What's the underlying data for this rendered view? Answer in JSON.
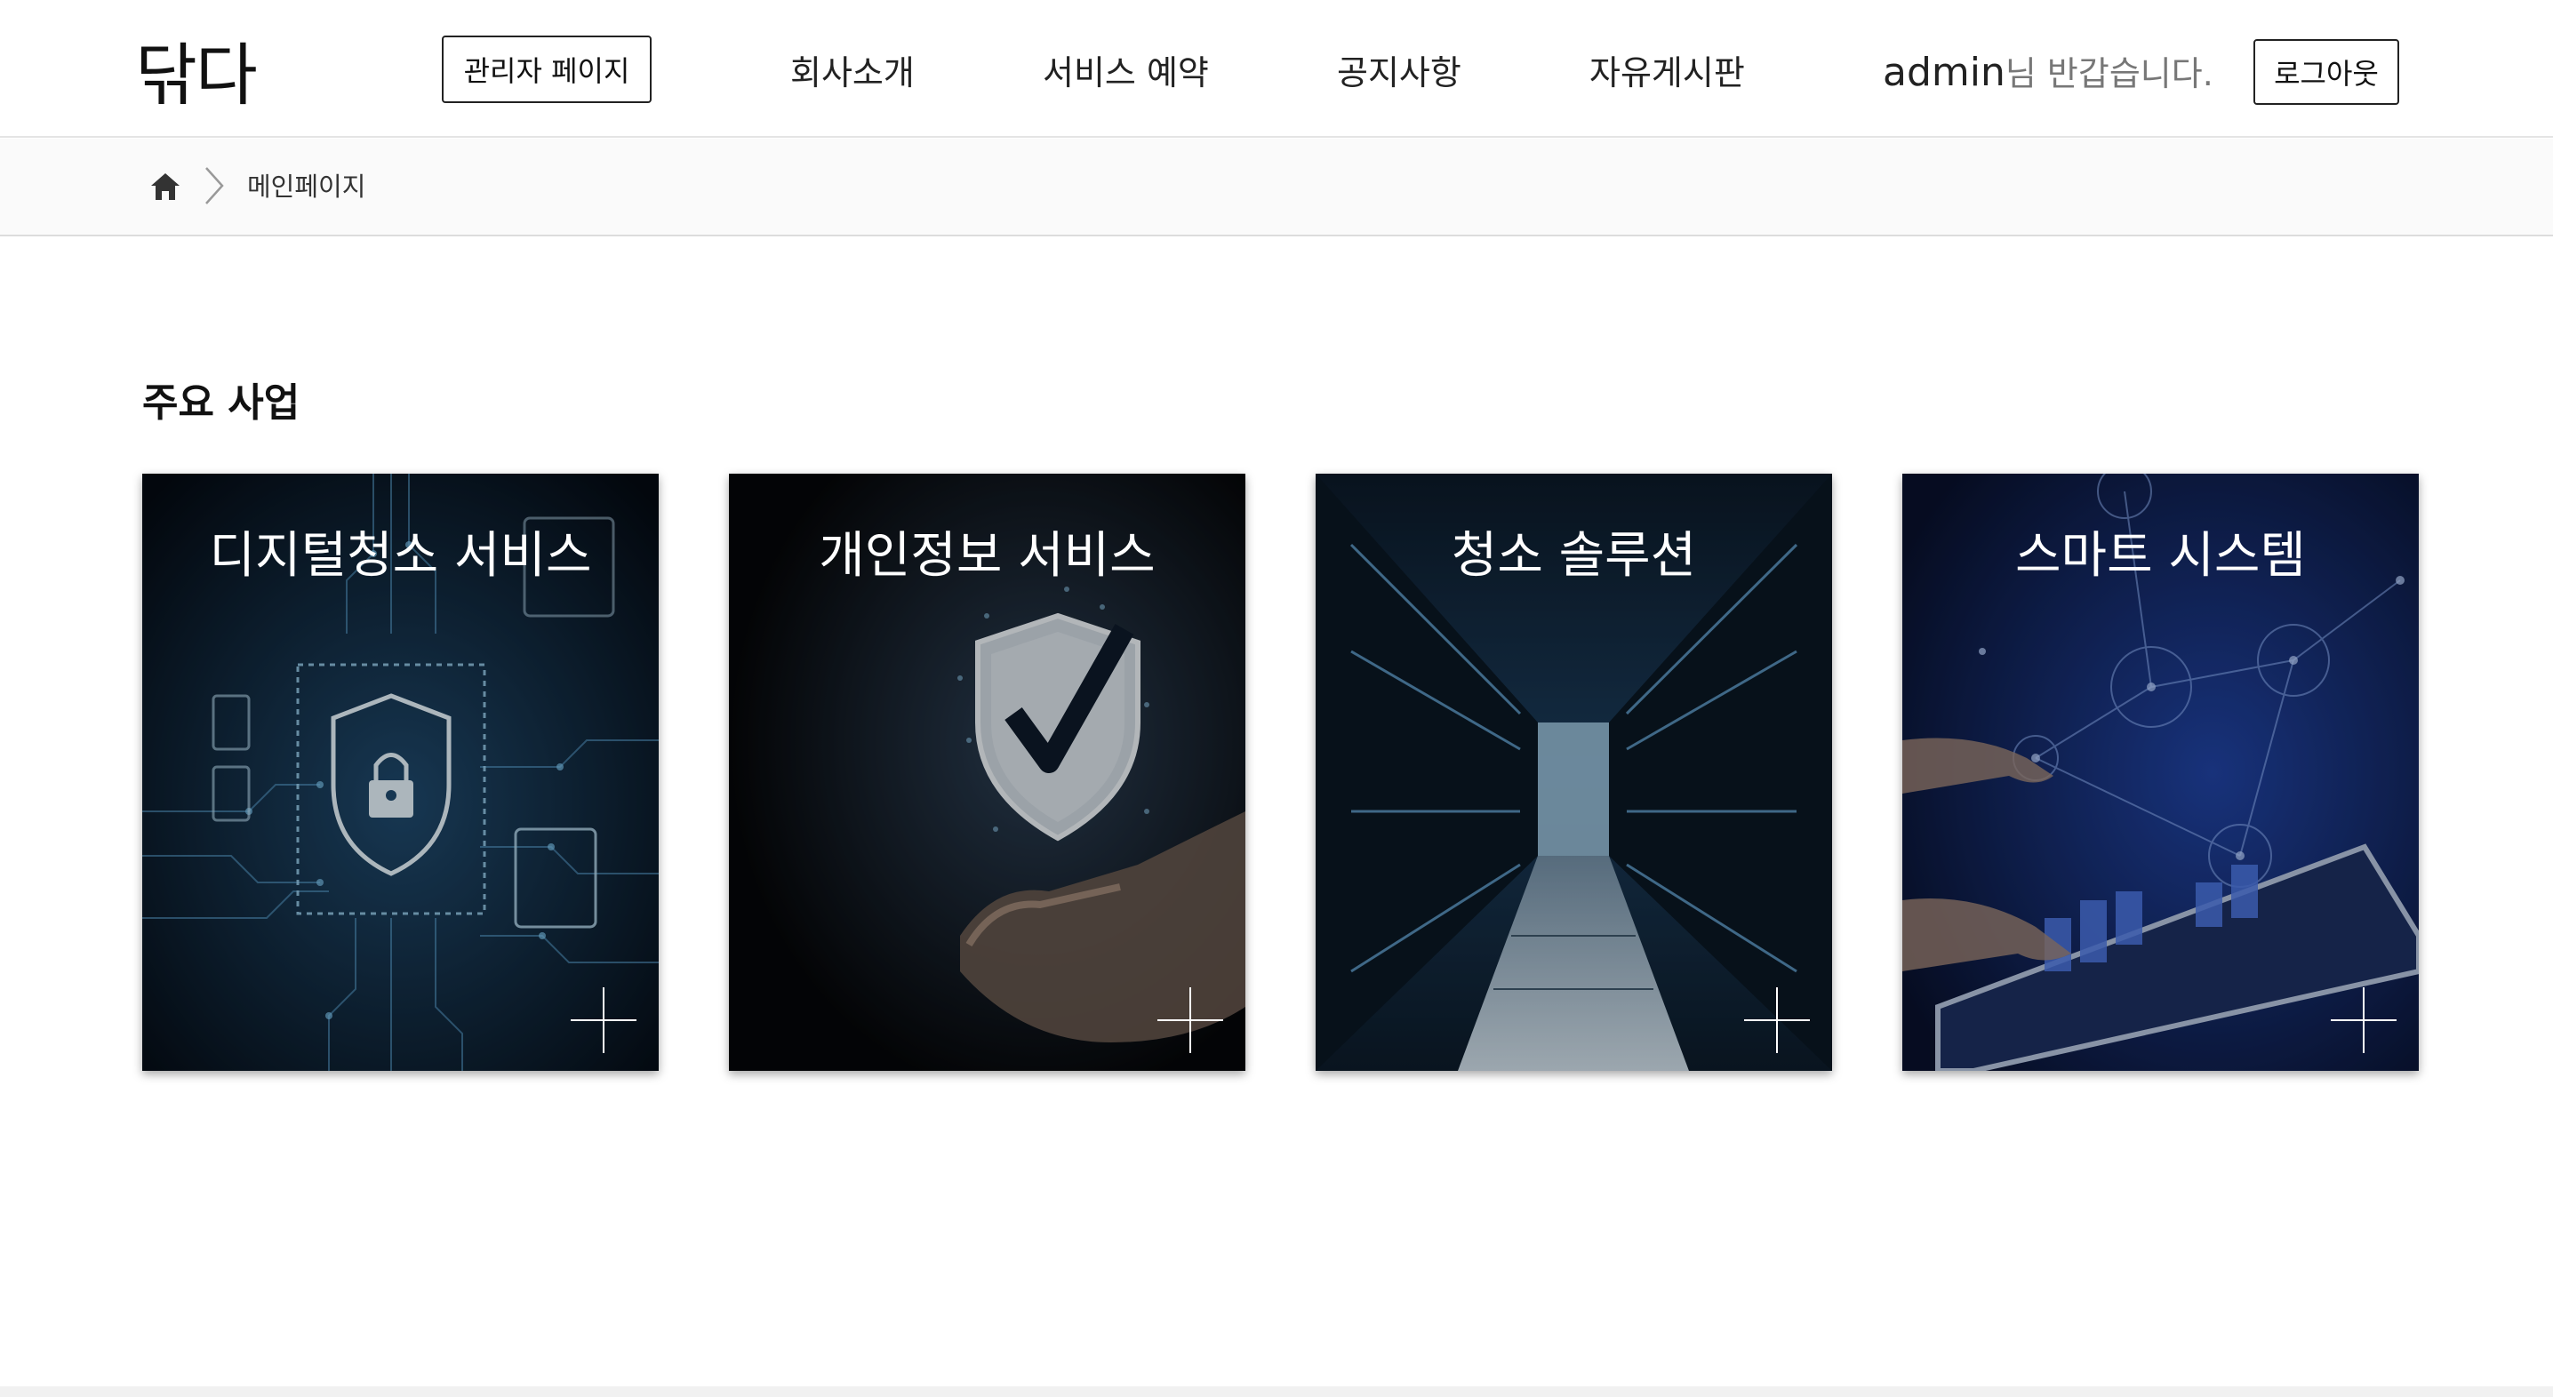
{
  "header": {
    "logo": "닦다",
    "admin_button": "관리자 페이지",
    "nav": [
      "회사소개",
      "서비스 예약",
      "공지사항",
      "자유게시판"
    ],
    "user_name": "admin",
    "greeting_suffix": "님 반갑습니다.",
    "logout_button": "로그아웃"
  },
  "breadcrumb": {
    "icons": [
      "home-icon",
      "chevron-right-icon"
    ],
    "current": "메인페이지"
  },
  "main": {
    "section_title": "주요 사업",
    "cards": [
      {
        "title": "디지털청소 서비스",
        "icon": "plus-icon"
      },
      {
        "title": "개인정보 서비스",
        "icon": "plus-icon"
      },
      {
        "title": "청소 솔루션",
        "icon": "plus-icon"
      },
      {
        "title": "스마트 시스템",
        "icon": "plus-icon"
      }
    ]
  },
  "colors": {
    "text": "#111111",
    "border": "#e4e4e4",
    "breadcrumb_bg": "#fafafa",
    "card_overlay": "#000000",
    "accent_blue": "#3a7bd5"
  }
}
